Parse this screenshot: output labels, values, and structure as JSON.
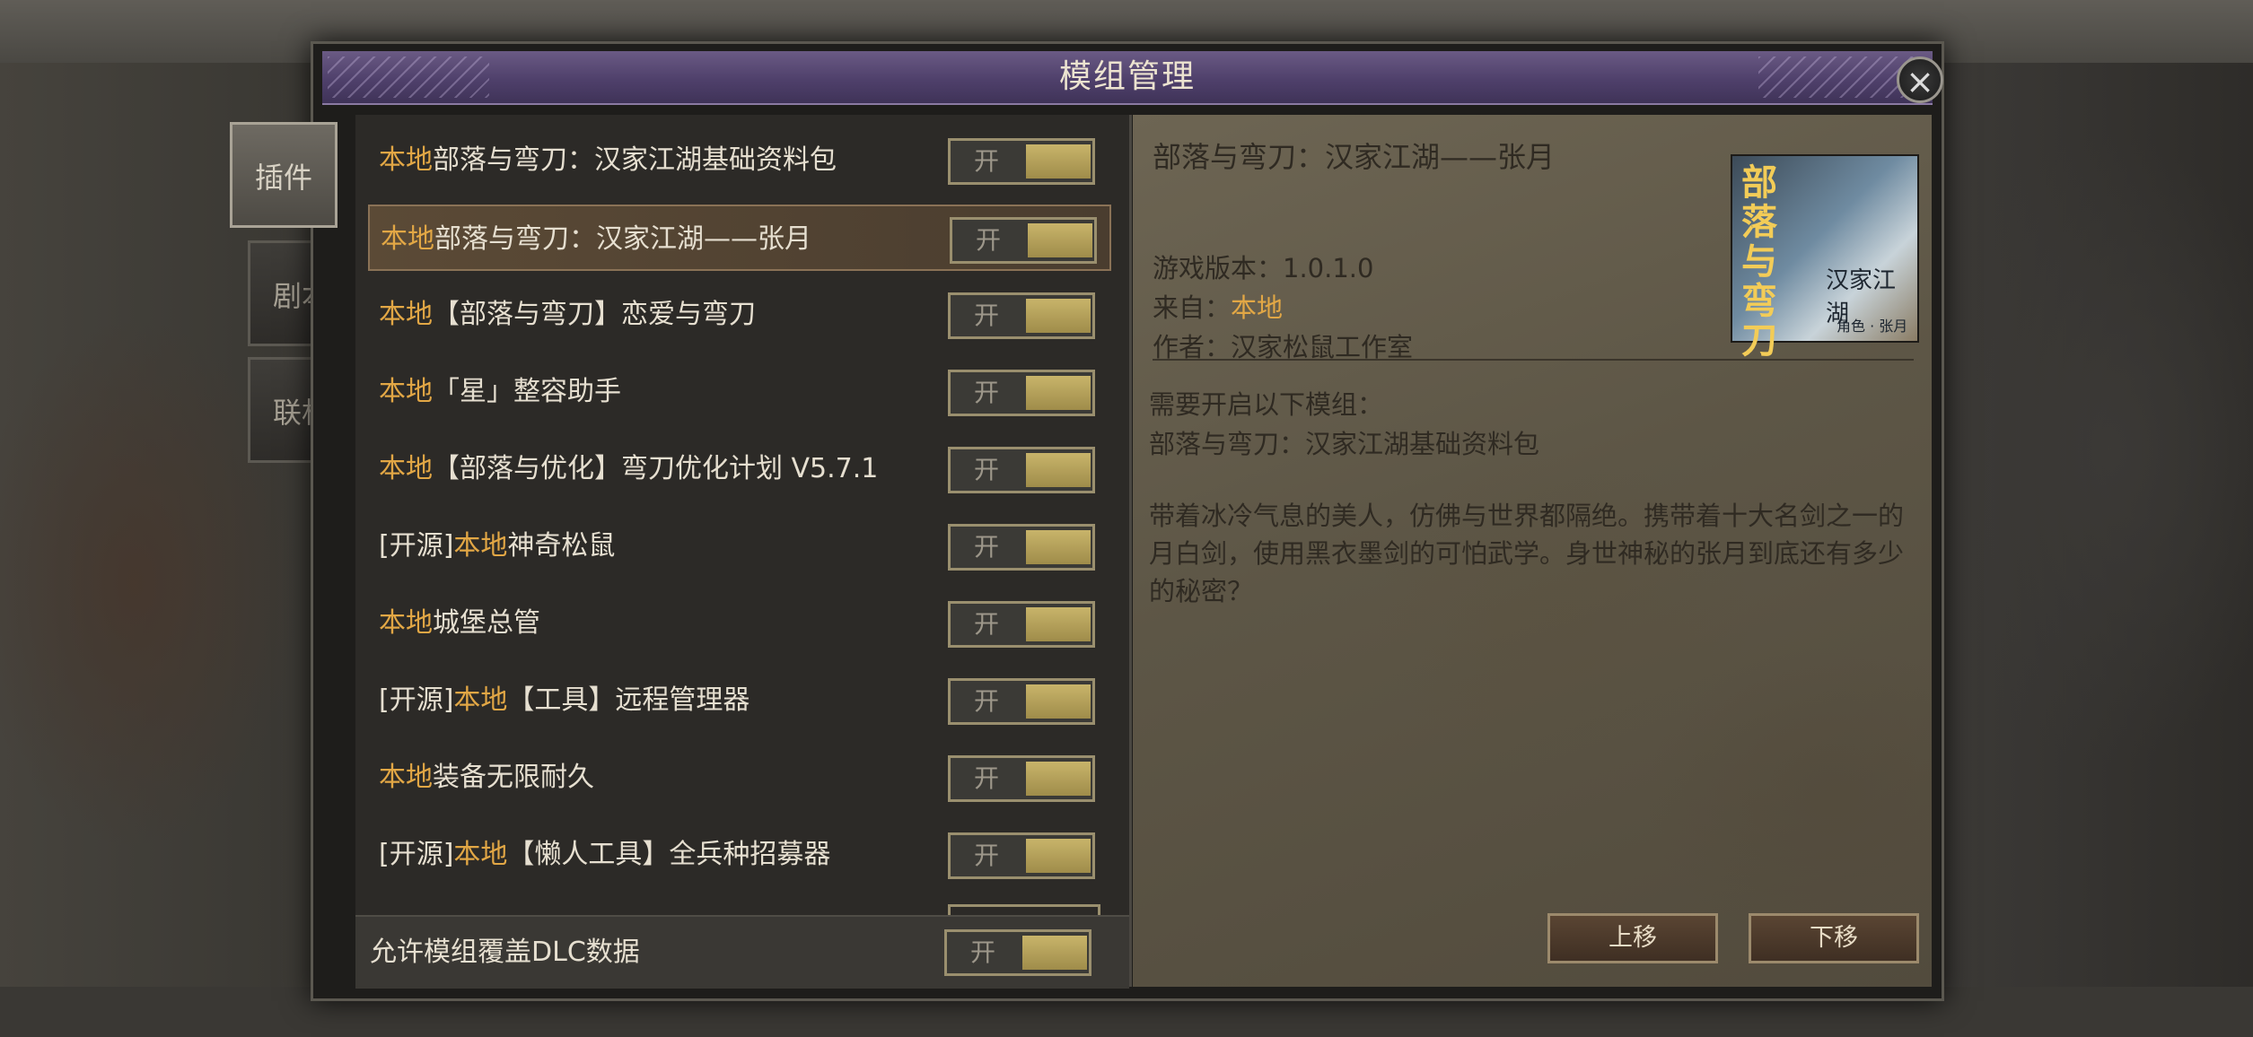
{
  "dialog": {
    "title": "模组管理",
    "close_icon": "close-icon"
  },
  "tabs": [
    {
      "label": "插件",
      "active": true
    },
    {
      "label": "剧本",
      "active": false
    },
    {
      "label": "联机",
      "active": false
    }
  ],
  "mods": [
    {
      "prefix": "",
      "tag": "本地",
      "name": "部落与弯刀：汉家江湖基础资料包",
      "toggle": "开",
      "selected": false
    },
    {
      "prefix": "",
      "tag": "本地",
      "name": "部落与弯刀：汉家江湖——张月",
      "toggle": "开",
      "selected": true
    },
    {
      "prefix": "",
      "tag": "本地",
      "name": "【部落与弯刀】恋爱与弯刀",
      "toggle": "开",
      "selected": false
    },
    {
      "prefix": "",
      "tag": "本地",
      "name": "「星」整容助手",
      "toggle": "开",
      "selected": false
    },
    {
      "prefix": "",
      "tag": "本地",
      "name": "【部落与优化】弯刀优化计划 V5.7.1",
      "toggle": "开",
      "selected": false
    },
    {
      "prefix": "[开源]",
      "tag": "本地",
      "name": "神奇松鼠",
      "toggle": "开",
      "selected": false
    },
    {
      "prefix": "",
      "tag": "本地",
      "name": "城堡总管",
      "toggle": "开",
      "selected": false
    },
    {
      "prefix": "[开源]",
      "tag": "本地",
      "name": "【工具】远程管理器",
      "toggle": "开",
      "selected": false
    },
    {
      "prefix": "",
      "tag": "本地",
      "name": "装备无限耐久",
      "toggle": "开",
      "selected": false
    },
    {
      "prefix": "[开源]",
      "tag": "本地",
      "name": "【懒人工具】全兵种招募器",
      "toggle": "开",
      "selected": false
    }
  ],
  "footer": {
    "label": "允许模组覆盖DLC数据",
    "toggle": "开"
  },
  "detail": {
    "name": "部落与弯刀：汉家江湖——张月",
    "version_label": "游戏版本：",
    "version": "1.0.1.0",
    "source_label": "来自：",
    "source": "本地",
    "author_label": "作者：",
    "author": "汉家松鼠工作室",
    "requires_label": "需要开启以下模组：",
    "requires": "部落与弯刀：汉家江湖基础资料包",
    "description": "带着冰冷气息的美人，仿佛与世界都隔绝。携带着十大名剑之一的月白剑，使用黑衣墨剑的可怕武学。身世神秘的张月到底还有多少的秘密？",
    "cover": {
      "title": "部落与弯刀",
      "subtitle": "汉家江湖",
      "caption": "角色 · 张月"
    },
    "move_up": "上移",
    "move_down": "下移"
  },
  "colors": {
    "accent_local": "#e2a745",
    "title_bar": "#5a4a78",
    "toggle_knob": "#b5a25c"
  }
}
